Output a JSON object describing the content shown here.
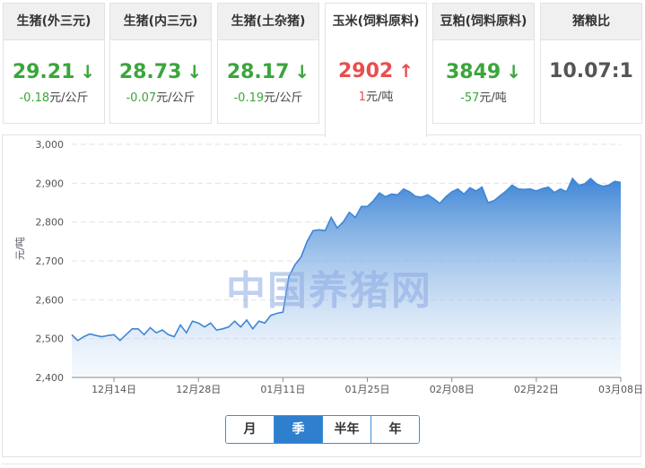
{
  "cards": [
    {
      "title": "生猪(外三元)",
      "price": "29.21",
      "direction": "down",
      "change": "-0.18",
      "unit": "元/公斤"
    },
    {
      "title": "生猪(内三元)",
      "price": "28.73",
      "direction": "down",
      "change": "-0.07",
      "unit": "元/公斤"
    },
    {
      "title": "生猪(土杂猪)",
      "price": "28.17",
      "direction": "down",
      "change": "-0.19",
      "unit": "元/公斤"
    },
    {
      "title": "玉米(饲料原料)",
      "price": "2902",
      "direction": "up",
      "change": "1",
      "unit": "元/吨"
    },
    {
      "title": "豆粕(饲料原料)",
      "price": "3849",
      "direction": "down",
      "change": "-57",
      "unit": "元/吨"
    },
    {
      "title": "猪粮比",
      "price": "10.07:1",
      "direction": "none",
      "change": "",
      "unit": ""
    }
  ],
  "active_card": 3,
  "icons": {
    "down": "arrow-down-icon",
    "up": "arrow-up-icon"
  },
  "colors": {
    "down": "#3aa63a",
    "up": "#e94e4e",
    "line": "#3f86d6",
    "fill_top": "#3f86d6",
    "fill_bottom": "#d9e8f8",
    "accent": "#2f7fcf"
  },
  "watermark": "中国养猪网",
  "range_buttons": [
    "月",
    "季",
    "半年",
    "年"
  ],
  "active_range": 1,
  "chart_data": {
    "type": "area",
    "ylabel": "元/吨",
    "ylim": [
      2400,
      3000
    ],
    "yticks": [
      2400,
      2500,
      2600,
      2700,
      2800,
      2900,
      3000
    ],
    "xlim": [
      "2020-12-07",
      "2021-03-08"
    ],
    "xticks": [
      "12月14日",
      "12月28日",
      "01月11日",
      "01月25日",
      "02月08日",
      "02月22日",
      "03月08日"
    ],
    "xtick_dates": [
      "2020-12-14",
      "2020-12-28",
      "2021-01-11",
      "2021-01-25",
      "2021-02-08",
      "2021-02-22",
      "2021-03-08"
    ],
    "grid": true,
    "legend": false,
    "series": [
      {
        "x": [
          "2020-12-07",
          "2020-12-08",
          "2020-12-09",
          "2020-12-10",
          "2020-12-11",
          "2020-12-12",
          "2020-12-13",
          "2020-12-14",
          "2020-12-15",
          "2020-12-16",
          "2020-12-17",
          "2020-12-18",
          "2020-12-19",
          "2020-12-20",
          "2020-12-21",
          "2020-12-22",
          "2020-12-23",
          "2020-12-24",
          "2020-12-25",
          "2020-12-26",
          "2020-12-27",
          "2020-12-28",
          "2020-12-29",
          "2020-12-30",
          "2020-12-31",
          "2021-01-01",
          "2021-01-02",
          "2021-01-03",
          "2021-01-04",
          "2021-01-05",
          "2021-01-06",
          "2021-01-07",
          "2021-01-08",
          "2021-01-09",
          "2021-01-10",
          "2021-01-11",
          "2021-01-12",
          "2021-01-13",
          "2021-01-14",
          "2021-01-15",
          "2021-01-16",
          "2021-01-17",
          "2021-01-18",
          "2021-01-19",
          "2021-01-20",
          "2021-01-21",
          "2021-01-22",
          "2021-01-23",
          "2021-01-24",
          "2021-01-25",
          "2021-01-26",
          "2021-01-27",
          "2021-01-28",
          "2021-01-29",
          "2021-01-30",
          "2021-01-31",
          "2021-02-01",
          "2021-02-02",
          "2021-02-03",
          "2021-02-04",
          "2021-02-05",
          "2021-02-06",
          "2021-02-07",
          "2021-02-08",
          "2021-02-09",
          "2021-02-10",
          "2021-02-11",
          "2021-02-12",
          "2021-02-13",
          "2021-02-14",
          "2021-02-15",
          "2021-02-16",
          "2021-02-17",
          "2021-02-18",
          "2021-02-19",
          "2021-02-20",
          "2021-02-21",
          "2021-02-22",
          "2021-02-23",
          "2021-02-24",
          "2021-02-25",
          "2021-02-26",
          "2021-02-27",
          "2021-02-28",
          "2021-03-01",
          "2021-03-02",
          "2021-03-03",
          "2021-03-04",
          "2021-03-05",
          "2021-03-06",
          "2021-03-07",
          "2021-03-08"
        ],
        "values": [
          2510,
          2495,
          2505,
          2512,
          2508,
          2505,
          2508,
          2510,
          2495,
          2510,
          2525,
          2525,
          2510,
          2528,
          2515,
          2522,
          2510,
          2505,
          2535,
          2515,
          2545,
          2540,
          2530,
          2540,
          2522,
          2525,
          2530,
          2545,
          2530,
          2548,
          2525,
          2545,
          2540,
          2560,
          2565,
          2568,
          2660,
          2690,
          2710,
          2750,
          2778,
          2780,
          2778,
          2812,
          2785,
          2800,
          2825,
          2812,
          2840,
          2840,
          2855,
          2875,
          2865,
          2872,
          2870,
          2885,
          2878,
          2866,
          2864,
          2870,
          2860,
          2848,
          2865,
          2878,
          2885,
          2872,
          2888,
          2880,
          2890,
          2850,
          2855,
          2868,
          2880,
          2895,
          2885,
          2884,
          2885,
          2880,
          2886,
          2890,
          2876,
          2885,
          2878,
          2912,
          2895,
          2898,
          2912,
          2898,
          2892,
          2895,
          2905,
          2902
        ]
      }
    ]
  }
}
